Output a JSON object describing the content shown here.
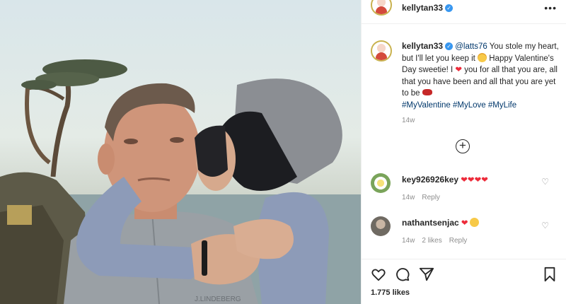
{
  "post": {
    "username": "kellytan33",
    "more_glyph": "•••",
    "verified_glyph": "✓"
  },
  "caption": {
    "username": "kellytan33",
    "mention": "@latts76",
    "text_1": " You stole my heart, but I'll let you keep it ",
    "text_2": " Happy Valentine's Day sweetie! I ",
    "text_3": " you for all that you are, all that you have been and all that you are yet to be ",
    "hashtags": "#MyValentine #MyLove #MyLife",
    "age": "14w",
    "heart_glyph": "❤"
  },
  "load_more_glyph": "+",
  "comments": [
    {
      "username": "key926926key",
      "text": "❤❤❤❤",
      "age": "14w",
      "reply": "Reply",
      "avatar_icon": "flower-avatar"
    },
    {
      "username": "nathantsenjac",
      "text": "❤",
      "age": "14w",
      "likes": "2 likes",
      "reply": "Reply",
      "avatar_icon": "person-avatar"
    }
  ],
  "like_count": "1.775 likes",
  "icons": [
    "heart-icon",
    "comment-icon",
    "share-icon",
    "bookmark-icon",
    "more-icon",
    "verified-icon",
    "add-comment-icon"
  ],
  "colors": {
    "link": "#00376b",
    "heart": "#ed2b3a",
    "verified": "#3897f0",
    "muted": "#8e8e8e"
  }
}
